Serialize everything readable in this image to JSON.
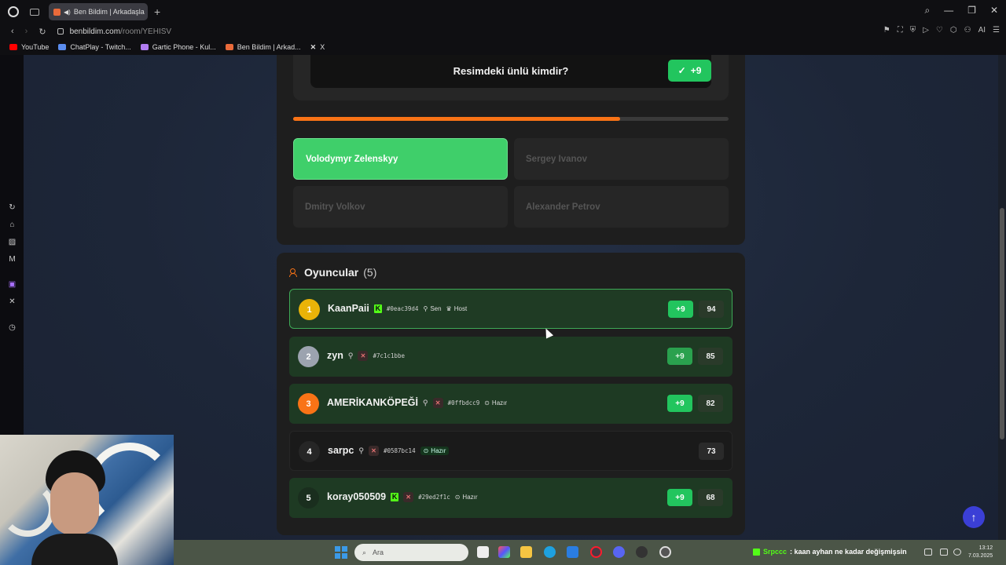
{
  "browser": {
    "tab_title": "Ben Bildim | Arkadaşla",
    "url_host": "benbildim.com",
    "url_path": "/room/YEHISV",
    "bookmarks": [
      {
        "label": "YouTube",
        "icon": "youtube-icon",
        "color": "#ff0000"
      },
      {
        "label": "ChatPlay - Twitch...",
        "icon": "chatplay-icon",
        "color": "#5b8def"
      },
      {
        "label": "Gartic Phone - Kul...",
        "icon": "gartic-icon",
        "color": "#b07cf0"
      },
      {
        "label": "Ben Bildim | Arkad...",
        "icon": "benbildim-icon",
        "color": "#e96a3a"
      },
      {
        "label": "X",
        "icon": "x-icon",
        "color": "#ffffff"
      }
    ],
    "ai_label": "AI"
  },
  "question": {
    "text": "Resimdeki ünlü kimdir?",
    "badge": "+9",
    "progress": 0.75
  },
  "options": [
    {
      "label": "Volodymyr Zelenskyy",
      "state": "correct"
    },
    {
      "label": "Sergey Ivanov",
      "state": "wrong"
    },
    {
      "label": "Dmitry Volkov",
      "state": "wrong"
    },
    {
      "label": "Alexander Petrov",
      "state": "wrong"
    }
  ],
  "players": {
    "title": "Oyuncular",
    "count": "(5)",
    "list": [
      {
        "rank": "1",
        "name": "KaanPaii",
        "hash": "#0eac39d4",
        "you": "Sen",
        "host": "Host",
        "plus": "+9",
        "score": "94"
      },
      {
        "rank": "2",
        "name": "zyn",
        "hash": "#7c1c1bbe",
        "plus": "+9",
        "score": "85"
      },
      {
        "rank": "3",
        "name": "AMERİKANKÖPEĞİ",
        "hash": "#0ffbdcc9",
        "ready": "Hazır",
        "plus": "+9",
        "score": "82"
      },
      {
        "rank": "4",
        "name": "sarpc",
        "hash": "#0587bc14",
        "ready": "Hazır",
        "score": "73"
      },
      {
        "rank": "5",
        "name": "koray050509",
        "hash": "#29ed2f1c",
        "ready": "Hazır",
        "plus": "+9",
        "score": "68"
      }
    ]
  },
  "taskbar": {
    "search_placeholder": "Ara",
    "chat_user": "Srpccc",
    "chat_message": ": kaan ayhan ne kadar değişmişsin",
    "time": "13:12",
    "date": "7.03.2025"
  },
  "colors": {
    "correct": "#3fcf6a",
    "accent_orange": "#f97316",
    "gain_green": "#22c55e",
    "rank1": "#eab308",
    "rank2": "#9ca3af",
    "rank3": "#f97316"
  }
}
